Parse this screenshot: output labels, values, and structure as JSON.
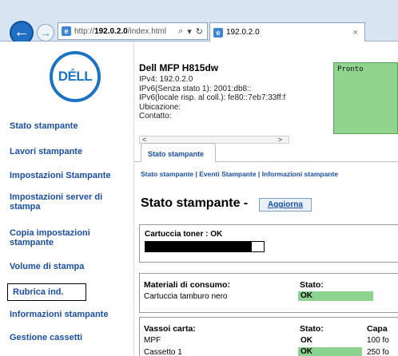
{
  "browser": {
    "address_prefix": "http://",
    "address_host": "192.0.2.0",
    "address_path": "/index.html",
    "address_tools": [
      "⌕",
      "▾",
      "↻"
    ],
    "tab_title": "192.0.2.0",
    "tab_close": "×"
  },
  "sidebar": {
    "logo": "DÉLL",
    "items": [
      {
        "label": "Stato stampante"
      },
      {
        "label": "Lavori stampante"
      },
      {
        "label": "Impostazioni Stampante"
      },
      {
        "label": "Impostazioni server di stampa"
      },
      {
        "label": "Copia impostazioni stampante"
      },
      {
        "label": "Volume di stampa"
      },
      {
        "label": "Rubrica ind."
      },
      {
        "label": "Informazioni stampante"
      },
      {
        "label": "Gestione cassetti"
      }
    ]
  },
  "device": {
    "name": "Dell MFP H815dw",
    "ipv4": "IPv4: 192.0.2.0",
    "ipv6_stateless": "IPv6(Senza stato 1): 2001:db8::",
    "ipv6_link": "IPv6(locale risp. al coll.): fe80::7eb7:33ff:f",
    "location": "Ubicazione:",
    "contact": "Contatto:",
    "status_text": "Pronto"
  },
  "tabs": {
    "active": "Stato stampante",
    "breadcrumb": "Stato stampante | Eventi Stampante | Informazioni stampante"
  },
  "status": {
    "title": "Stato stampante -",
    "refresh_label": "Aggiorna",
    "toner_label": "Cartuccia toner : OK",
    "toner_level": 0.9
  },
  "consumables": {
    "header": "Materiali di consumo:",
    "status_header": "Stato:",
    "rows": [
      {
        "name": "Cartuccia tamburo nero",
        "status": "OK"
      }
    ]
  },
  "trays": {
    "header": "Vassoi carta:",
    "status_header": "Stato:",
    "capacity_header": "Capa",
    "rows": [
      {
        "name": "MPF",
        "status": "OK",
        "capacity": "100 fo"
      },
      {
        "name": "Cassetto 1",
        "status": "OK",
        "capacity": "250 fo"
      }
    ]
  },
  "colors": {
    "link": "#1a4fa6",
    "ok_green": "#8bd38f",
    "status_panel": "#90d58e",
    "dell_blue": "#1e74c4"
  }
}
